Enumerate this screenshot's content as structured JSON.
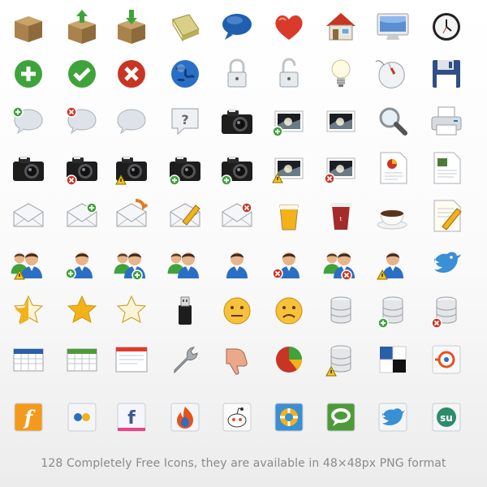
{
  "caption": "128 Completely Free Icons, they are available in 48×48px PNG format",
  "rows": [
    [
      "box-icon",
      "box-upload-icon",
      "box-download-icon",
      "book-icon",
      "speech-bubble-blue-icon",
      "heart-icon",
      "home-icon",
      "monitor-icon",
      "clock-icon"
    ],
    [
      "add-green-icon",
      "check-green-icon",
      "delete-red-icon",
      "globe-icon",
      "lock-closed-icon",
      "lock-open-icon",
      "lightbulb-icon",
      "mouse-icon",
      "floppy-disk-icon"
    ],
    [
      "comment-add-icon",
      "comment-delete-icon",
      "comment-icon",
      "help-question-icon",
      "camera-icon",
      "image-add-icon",
      "image-icon",
      "magnifier-icon",
      "printer-icon"
    ],
    [
      "camera-add-icon",
      "camera-delete-icon",
      "camera-warning-icon",
      "camera-add-alt-icon",
      "camera-add-small-icon",
      "image-warning-icon",
      "image-delete-icon",
      "document-chart-icon",
      "document-image-icon"
    ],
    [
      "mail-open-icon",
      "mail-add-icon",
      "mail-forward-icon",
      "mail-edit-icon",
      "mail-delete-icon",
      "beer-glass-icon",
      "coffee-cup-paper-icon",
      "coffee-cup-icon",
      "document-edit-icon"
    ],
    [
      "users-warning-icon",
      "user-add-icon",
      "users-add-icon",
      "users-icon",
      "user-icon",
      "user-delete-icon",
      "users-delete-icon",
      "user-warning-icon",
      "twitter-bird-icon"
    ],
    [
      "star-half-icon",
      "star-full-icon",
      "star-empty-icon",
      "usb-drive-icon",
      "smiley-sad-icon",
      "smiley-unhappy-icon",
      "database-icon",
      "database-add-icon",
      "database-delete-icon"
    ],
    [
      "table-blue-icon",
      "table-green-icon",
      "application-window-icon",
      "wrench-icon",
      "thumbs-down-icon",
      "pie-chart-icon",
      "database-warning-icon",
      "delicious-icon",
      "mixx-icon"
    ],
    [
      "friendfeed-icon",
      "flickr-icon",
      "facebook-icon",
      "feedburner-icon",
      "reddit-icon",
      "lifebuoy-icon",
      "technorati-icon",
      "twitter-icon",
      "stumbleupon-icon"
    ]
  ],
  "colors": {
    "green": "#3fa33b",
    "red": "#c83524",
    "blue": "#2a6fc5",
    "cream": "#eaedf0",
    "box": "#a9834b",
    "gold": "#f3b21a",
    "gray": "#9aa0a6"
  }
}
